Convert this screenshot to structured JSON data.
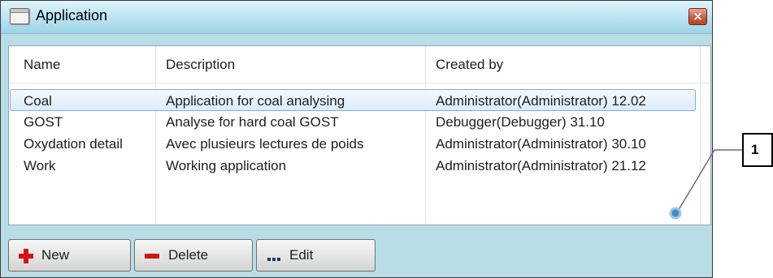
{
  "window": {
    "title": "Application",
    "close_glyph": "×",
    "title_icon": "window-icon"
  },
  "list": {
    "columns": [
      "Name",
      "Description",
      "Created by"
    ],
    "rows": [
      {
        "name": "Coal",
        "description": "Application for coal analysing",
        "created_by": "Administrator(Administrator) 12.02",
        "selected": true
      },
      {
        "name": "GOST",
        "description": "Analyse for hard coal GOST",
        "created_by": "Debugger(Debugger) 31.10",
        "selected": false
      },
      {
        "name": "Oxydation detail",
        "description": "Avec plusieurs lectures de poids",
        "created_by": "Administrator(Administrator) 30.10",
        "selected": false
      },
      {
        "name": "Work",
        "description": "Working application",
        "created_by": "Administrator(Administrator) 21.12",
        "selected": false
      }
    ]
  },
  "toolbar": {
    "new_label": "New",
    "delete_label": "Delete",
    "edit_label": "Edit",
    "new_icon": "plus-icon",
    "delete_icon": "minus-icon",
    "edit_icon": "dots-icon"
  },
  "callout": {
    "number": "1"
  },
  "colors": {
    "titlebar": "#bfe6f4",
    "window_bg": "#b9dde6",
    "selection_border": "#84acdd",
    "icon_red": "#d41414",
    "close_red": "#cd5b41",
    "callout_line": "#3f8fc0"
  }
}
